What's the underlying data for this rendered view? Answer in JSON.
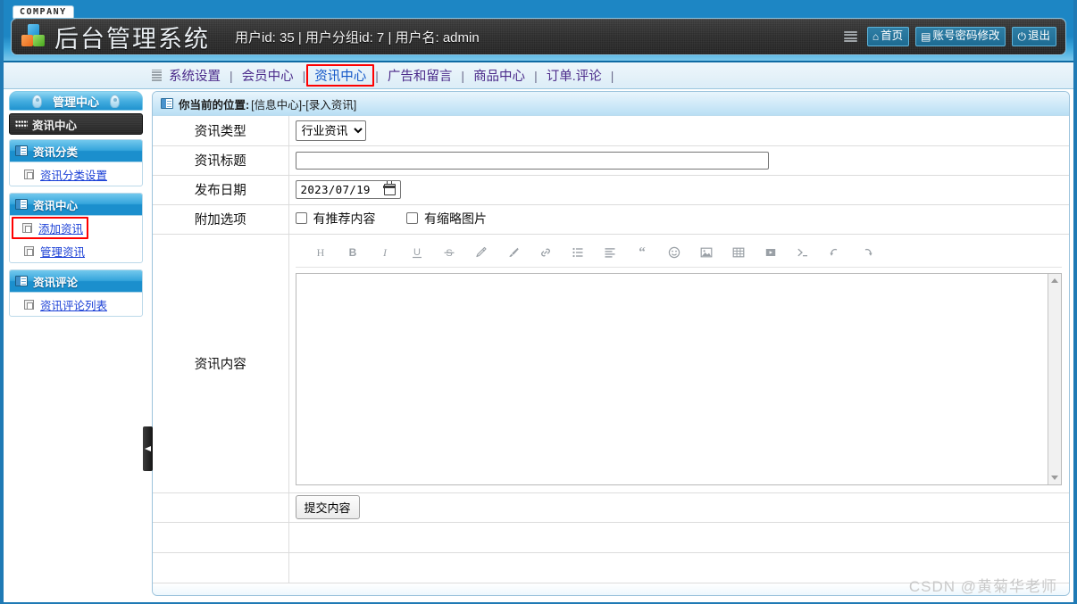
{
  "header": {
    "company_badge": "COMPANY",
    "system_title": "后台管理系统",
    "user_info": "用户id: 35 | 用户分组id: 7 | 用户名: admin",
    "buttons": [
      {
        "icon": "home-icon",
        "glyph": "⌂",
        "label": "首页"
      },
      {
        "icon": "list-icon",
        "glyph": "▤",
        "label": "账号密码修改"
      },
      {
        "icon": "power-icon",
        "glyph": "⏻",
        "label": "退出"
      }
    ]
  },
  "nav": {
    "separator": "|",
    "tabs": [
      {
        "label": "系统设置",
        "active": false
      },
      {
        "label": "会员中心",
        "active": false
      },
      {
        "label": "资讯中心",
        "active": true
      },
      {
        "label": "广告和留言",
        "active": false
      },
      {
        "label": "商品中心",
        "active": false
      },
      {
        "label": "订单.评论",
        "active": false
      }
    ]
  },
  "sidebar": {
    "title": "管理中心",
    "current": "资讯中心",
    "groups": [
      {
        "head": "资讯分类",
        "items": [
          {
            "label": "资讯分类设置",
            "highlighted": false
          }
        ]
      },
      {
        "head": "资讯中心",
        "items": [
          {
            "label": "添加资讯",
            "highlighted": true
          },
          {
            "label": "管理资讯",
            "highlighted": false
          }
        ]
      },
      {
        "head": "资讯评论",
        "items": [
          {
            "label": "资讯评论列表",
            "highlighted": false
          }
        ]
      }
    ]
  },
  "breadcrumb": {
    "label": "你当前的位置:",
    "path": "[信息中心]-[录入资讯]"
  },
  "form": {
    "rows": {
      "type_label": "资讯类型",
      "type_value": "行业资讯",
      "type_options": [
        "行业资讯"
      ],
      "title_label": "资讯标题",
      "title_value": "",
      "title_placeholder": "",
      "date_label": "发布日期",
      "date_value": "2023/07/19",
      "extra_label": "附加选项",
      "extra_options": [
        {
          "label": "有推荐内容",
          "checked": false
        },
        {
          "label": "有缩略图片",
          "checked": false
        }
      ],
      "content_label": "资讯内容",
      "content_value": ""
    },
    "submit_label": "提交内容"
  },
  "editor_toolbar": [
    {
      "name": "heading-icon",
      "glyph": "H"
    },
    {
      "name": "bold-icon",
      "glyph": "B"
    },
    {
      "name": "italic-icon",
      "glyph": "I"
    },
    {
      "name": "underline-icon",
      "glyph": "U"
    },
    {
      "name": "strikethrough-icon",
      "glyph": "S"
    },
    {
      "name": "pen-icon",
      "glyph": "✎"
    },
    {
      "name": "brush-icon",
      "glyph": "🖌"
    },
    {
      "name": "link-icon",
      "glyph": "🔗"
    },
    {
      "name": "bullet-list-icon",
      "glyph": "☰"
    },
    {
      "name": "align-left-icon",
      "glyph": "≡"
    },
    {
      "name": "quote-icon",
      "glyph": "❝"
    },
    {
      "name": "emoji-icon",
      "glyph": "☺"
    },
    {
      "name": "image-icon",
      "glyph": "🖼"
    },
    {
      "name": "table-icon",
      "glyph": "▦"
    },
    {
      "name": "video-icon",
      "glyph": "▶"
    },
    {
      "name": "code-icon",
      "glyph": ">_"
    },
    {
      "name": "undo-icon",
      "glyph": "↺"
    },
    {
      "name": "redo-icon",
      "glyph": "↻"
    }
  ],
  "watermark": "CSDN @黄菊华老师",
  "colors": {
    "frame_blue": "#1f7ab5",
    "accent_blue": "#1d86c4",
    "highlight_red": "#ff0000",
    "link_blue": "#1a3fd6",
    "nav_purple": "#4b2a8a"
  }
}
